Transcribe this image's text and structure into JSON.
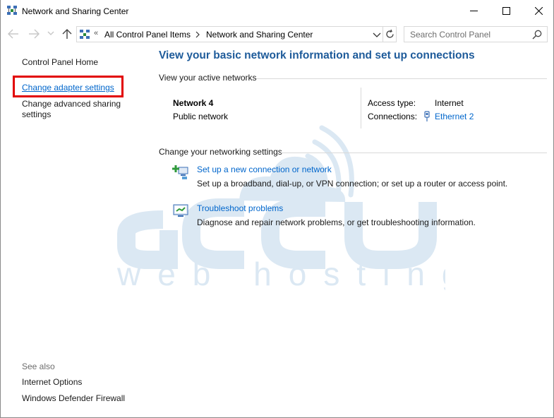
{
  "window": {
    "title": "Network and Sharing Center",
    "controls": {
      "minimize": "minimize",
      "maximize": "maximize",
      "close": "close"
    }
  },
  "address": {
    "overflow": "«",
    "crumbs": [
      "All Control Panel Items",
      "Network and Sharing Center"
    ]
  },
  "search": {
    "placeholder": "Search Control Panel"
  },
  "sidebar": {
    "home": "Control Panel Home",
    "adapter": "Change adapter settings",
    "advanced": "Change advanced sharing settings",
    "see_also_label": "See also",
    "see_also": [
      "Internet Options",
      "Windows Defender Firewall"
    ]
  },
  "main": {
    "title": "View your basic network information and set up connections",
    "active_label": "View your active networks",
    "network": {
      "name": "Network 4",
      "type": "Public network",
      "access_label": "Access type:",
      "access_value": "Internet",
      "connections_label": "Connections:",
      "connections_value": "Ethernet 2"
    },
    "change_label": "Change your networking settings",
    "tasks": [
      {
        "title": "Set up a new connection or network",
        "desc": "Set up a broadband, dial-up, or VPN connection; or set up a router or access point.",
        "icon": "new-connection-icon"
      },
      {
        "title": "Troubleshoot problems",
        "desc": "Diagnose and repair network problems, or get troubleshooting information.",
        "icon": "troubleshoot-icon"
      }
    ]
  },
  "watermark": {
    "word": "accu",
    "sub": "web hosting"
  },
  "colors": {
    "link": "#0066cc",
    "title_blue": "#1e5b9a",
    "highlight": "#e20000",
    "watermark": "#dbe8f3"
  }
}
